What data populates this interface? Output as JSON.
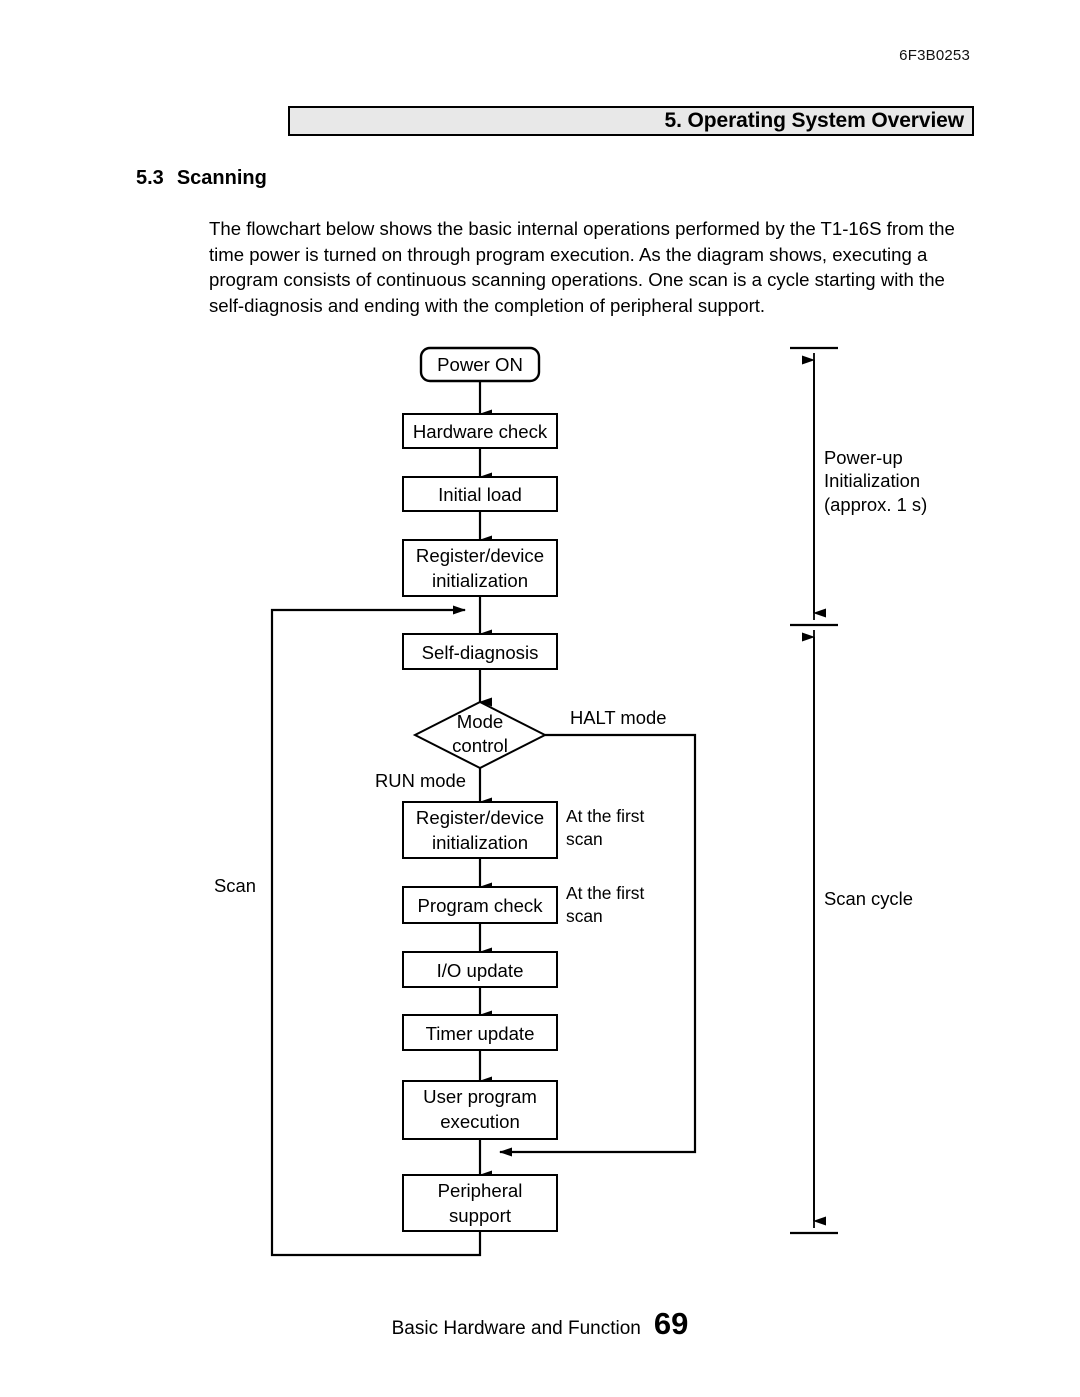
{
  "page": {
    "doc_number": "6F3B0253",
    "header_title": "5. Operating System Overview",
    "section_number": "5.3",
    "section_title": "Scanning",
    "intro_paragraph": "The flowchart below shows the basic internal operations performed by the T1-16S from the time power is turned on through program execution. As the diagram shows, executing a program consists of continuous scanning operations. One scan is a cycle starting with the self-diagnosis and ending with the completion of peripheral support.",
    "footer_text": "Basic Hardware and Function",
    "footer_page": "69"
  },
  "flowchart": {
    "nodes": {
      "power_on": "Power ON",
      "hardware_check": "Hardware check",
      "initial_load": "Initial load",
      "register_device_init_1_line1": "Register/device",
      "register_device_init_1_line2": "initialization",
      "self_diagnosis": "Self-diagnosis",
      "mode_control_line1": "Mode",
      "mode_control_line2": "control",
      "register_device_init_2_line1": "Register/device",
      "register_device_init_2_line2": "initialization",
      "program_check": "Program check",
      "io_update": "I/O update",
      "timer_update": "Timer update",
      "user_program_line1": "User program",
      "user_program_line2": "execution",
      "peripheral_support_line1": "Peripheral",
      "peripheral_support_line2": "support"
    },
    "edge_labels": {
      "halt_mode": "HALT mode",
      "run_mode": "RUN mode",
      "scan_loop": "Scan"
    },
    "annotations": {
      "at_first_scan_1_line1": "At the first",
      "at_first_scan_1_line2": "scan",
      "at_first_scan_2_line1": "At the first",
      "at_first_scan_2_line2": "scan",
      "powerup_line1": "Power-up",
      "powerup_line2": "Initialization",
      "powerup_line3": "(approx. 1 s)",
      "scan_cycle": "Scan cycle"
    }
  },
  "colors": {
    "header_bar_bg": "#e8e8e8",
    "line": "#000000",
    "text": "#000000"
  }
}
